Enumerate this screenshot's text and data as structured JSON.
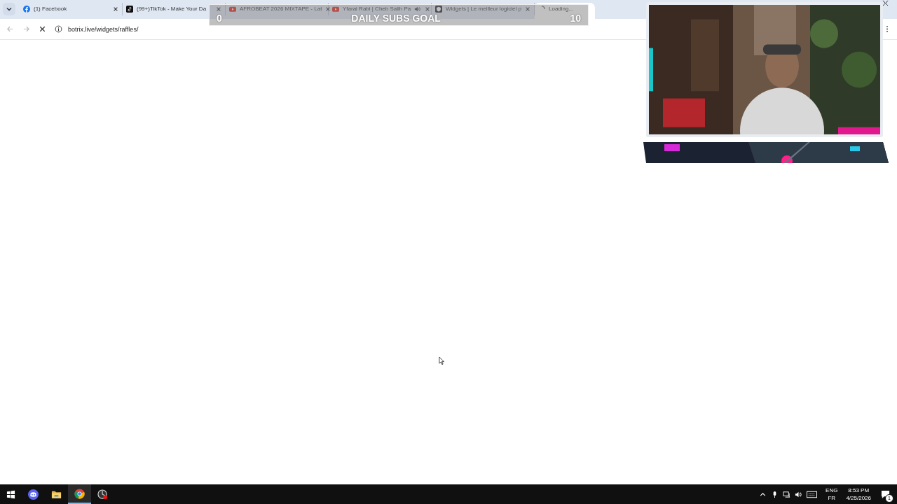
{
  "tabs": [
    {
      "kind": "facebook",
      "title": "(1) Facebook",
      "selected": false,
      "audio": false
    },
    {
      "kind": "tiktok",
      "title": "(99+)TikTok - Make Your Da",
      "selected": false,
      "audio": false
    },
    {
      "kind": "youtube",
      "title": "AFROBEAT 2026 MIXTAPE - Lat",
      "selected": false,
      "audio": false
    },
    {
      "kind": "youtube",
      "title": "Yfarai Rabi | Cheb Salih Pa",
      "selected": false,
      "audio": true
    },
    {
      "kind": "widgets",
      "title": "Widgets | Le meilleur logiciel p",
      "selected": false,
      "audio": false
    },
    {
      "kind": "loading",
      "title": "Loading...",
      "selected": true,
      "audio": false
    }
  ],
  "address": "botrix.live/widgets/raffles/",
  "goal": {
    "current": "0",
    "title": "DAILY SUBS GOAL",
    "target": "10",
    "level": 0
  },
  "taskbar": {
    "apps": [
      {
        "kind": "discord",
        "active": false
      },
      {
        "kind": "folder",
        "active": false
      },
      {
        "kind": "chrome",
        "active": true
      },
      {
        "kind": "recorder",
        "active": false
      }
    ],
    "language": "ENG",
    "layout": "FR",
    "time": "8:53 PM",
    "date": "4/25/2026",
    "notifications": "1"
  }
}
